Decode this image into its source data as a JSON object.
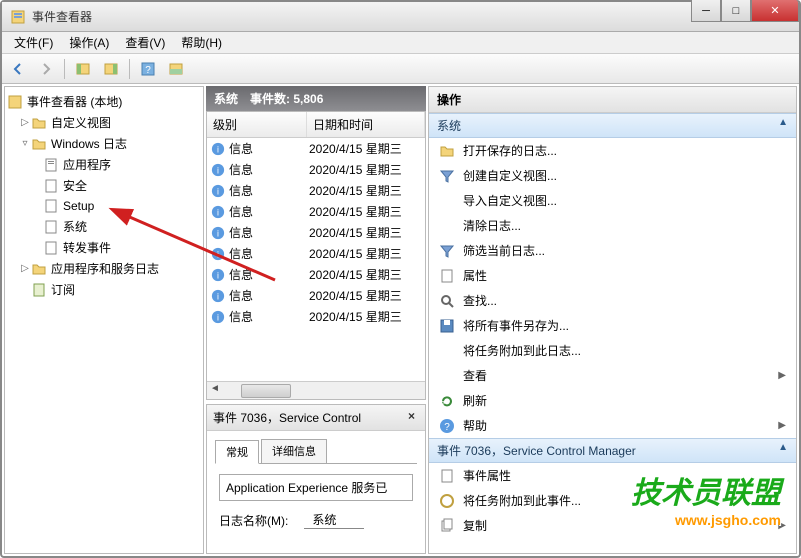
{
  "window": {
    "title": "事件查看器"
  },
  "menubar": {
    "file": "文件(F)",
    "action": "操作(A)",
    "view": "查看(V)",
    "help": "帮助(H)"
  },
  "tree": {
    "root": "事件查看器 (本地)",
    "custom_views": "自定义视图",
    "windows_logs": "Windows 日志",
    "app": "应用程序",
    "security": "安全",
    "setup": "Setup",
    "system": "系统",
    "forwarded": "转发事件",
    "apps_services": "应用程序和服务日志",
    "subscriptions": "订阅"
  },
  "events_header": {
    "name": "系统",
    "count_label": "事件数: 5,806"
  },
  "table": {
    "col_level": "级别",
    "col_datetime": "日期和时间",
    "rows": [
      {
        "level": "信息",
        "dt": "2020/4/15 星期三"
      },
      {
        "level": "信息",
        "dt": "2020/4/15 星期三"
      },
      {
        "level": "信息",
        "dt": "2020/4/15 星期三"
      },
      {
        "level": "信息",
        "dt": "2020/4/15 星期三"
      },
      {
        "level": "信息",
        "dt": "2020/4/15 星期三"
      },
      {
        "level": "信息",
        "dt": "2020/4/15 星期三"
      },
      {
        "level": "信息",
        "dt": "2020/4/15 星期三"
      },
      {
        "level": "信息",
        "dt": "2020/4/15 星期三"
      },
      {
        "level": "信息",
        "dt": "2020/4/15 星期三"
      }
    ]
  },
  "detail": {
    "title": "事件 7036，Service Control",
    "tab_general": "常规",
    "tab_details": "详细信息",
    "message": "Application Experience 服务已",
    "logname_label": "日志名称(M):",
    "logname_value": "系统"
  },
  "actions": {
    "title": "操作",
    "section1": "系统",
    "open_saved": "打开保存的日志...",
    "create_view": "创建自定义视图...",
    "import_view": "导入自定义视图...",
    "clear_log": "清除日志...",
    "filter_log": "筛选当前日志...",
    "properties": "属性",
    "find": "查找...",
    "save_all": "将所有事件另存为...",
    "attach_task": "将任务附加到此日志...",
    "view": "查看",
    "refresh": "刷新",
    "help": "帮助",
    "section2": "事件 7036，Service Control Manager",
    "event_props": "事件属性",
    "attach_task2": "将任务附加到此事件...",
    "copy": "复制"
  },
  "watermark": {
    "text": "技术员联盟",
    "url": "www.jsgho.com"
  }
}
